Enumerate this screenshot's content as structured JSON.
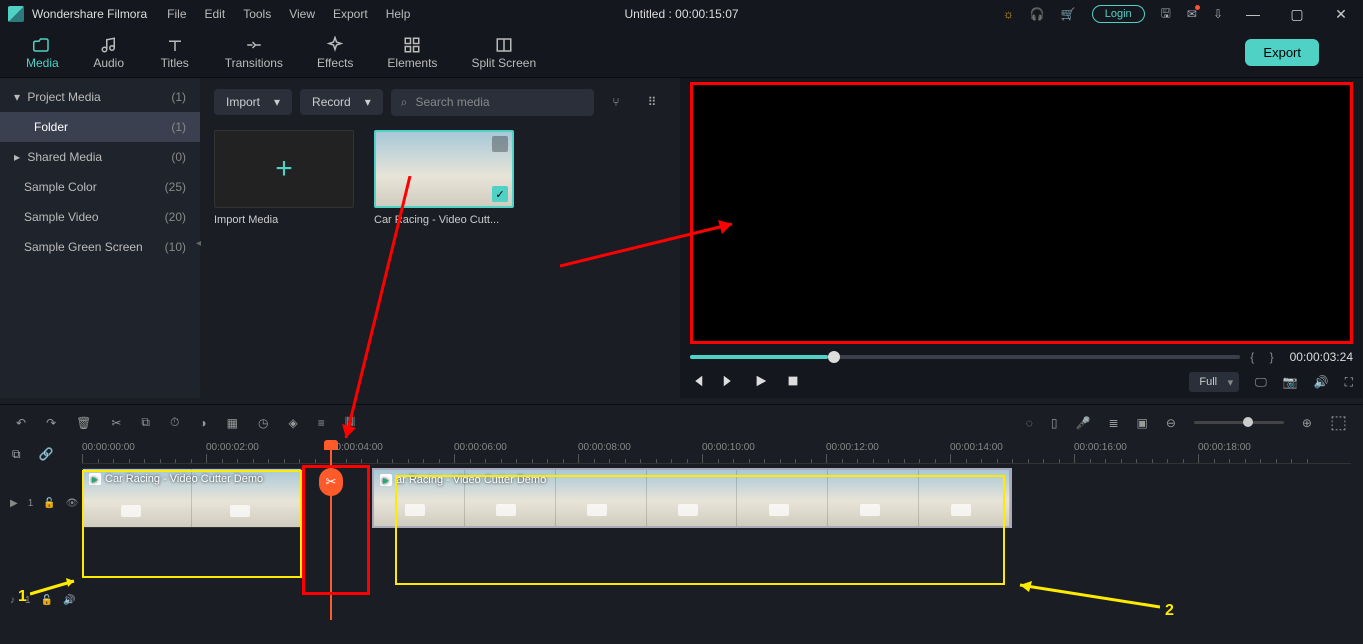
{
  "app": {
    "name": "Wondershare Filmora",
    "title_center": "Untitled : 00:00:15:07"
  },
  "menu": [
    "File",
    "Edit",
    "Tools",
    "View",
    "Export",
    "Help"
  ],
  "login": "Login",
  "tabs": [
    {
      "label": "Media",
      "active": true
    },
    {
      "label": "Audio"
    },
    {
      "label": "Titles"
    },
    {
      "label": "Transitions"
    },
    {
      "label": "Effects"
    },
    {
      "label": "Elements"
    },
    {
      "label": "Split Screen"
    }
  ],
  "export_btn": "Export",
  "sidebar": {
    "items": [
      {
        "label": "Project Media",
        "count": "(1)",
        "expandable": true,
        "expanded": true
      },
      {
        "label": "Folder",
        "count": "(1)",
        "selected": true,
        "sub": true
      },
      {
        "label": "Shared Media",
        "count": "(0)",
        "expandable": true
      },
      {
        "label": "Sample Color",
        "count": "(25)"
      },
      {
        "label": "Sample Video",
        "count": "(20)"
      },
      {
        "label": "Sample Green Screen",
        "count": "(10)"
      }
    ]
  },
  "media_toolbar": {
    "import": "Import",
    "record": "Record",
    "search_placeholder": "Search media"
  },
  "media_items": {
    "import_label": "Import Media",
    "clip_label": "Car Racing - Video Cutt..."
  },
  "preview": {
    "time": "00:00:03:24",
    "quality": "Full",
    "progress_pct": 25
  },
  "ruler_marks": [
    "00:00:00:00",
    "00:00:02:00",
    "00:00:04:00",
    "00:00:06:00",
    "00:00:08:00",
    "00:00:10:00",
    "00:00:12:00",
    "00:00:14:00",
    "00:00:16:00",
    "00:00:18:00"
  ],
  "clips": {
    "clip1_label": "Car Racing - Video Cutter Demo",
    "clip2_label": "ar Racing - Video Cutter Demo"
  },
  "track_labels": {
    "video": "1",
    "audio": "1"
  },
  "annotations": {
    "n1": "1",
    "n2": "2"
  }
}
